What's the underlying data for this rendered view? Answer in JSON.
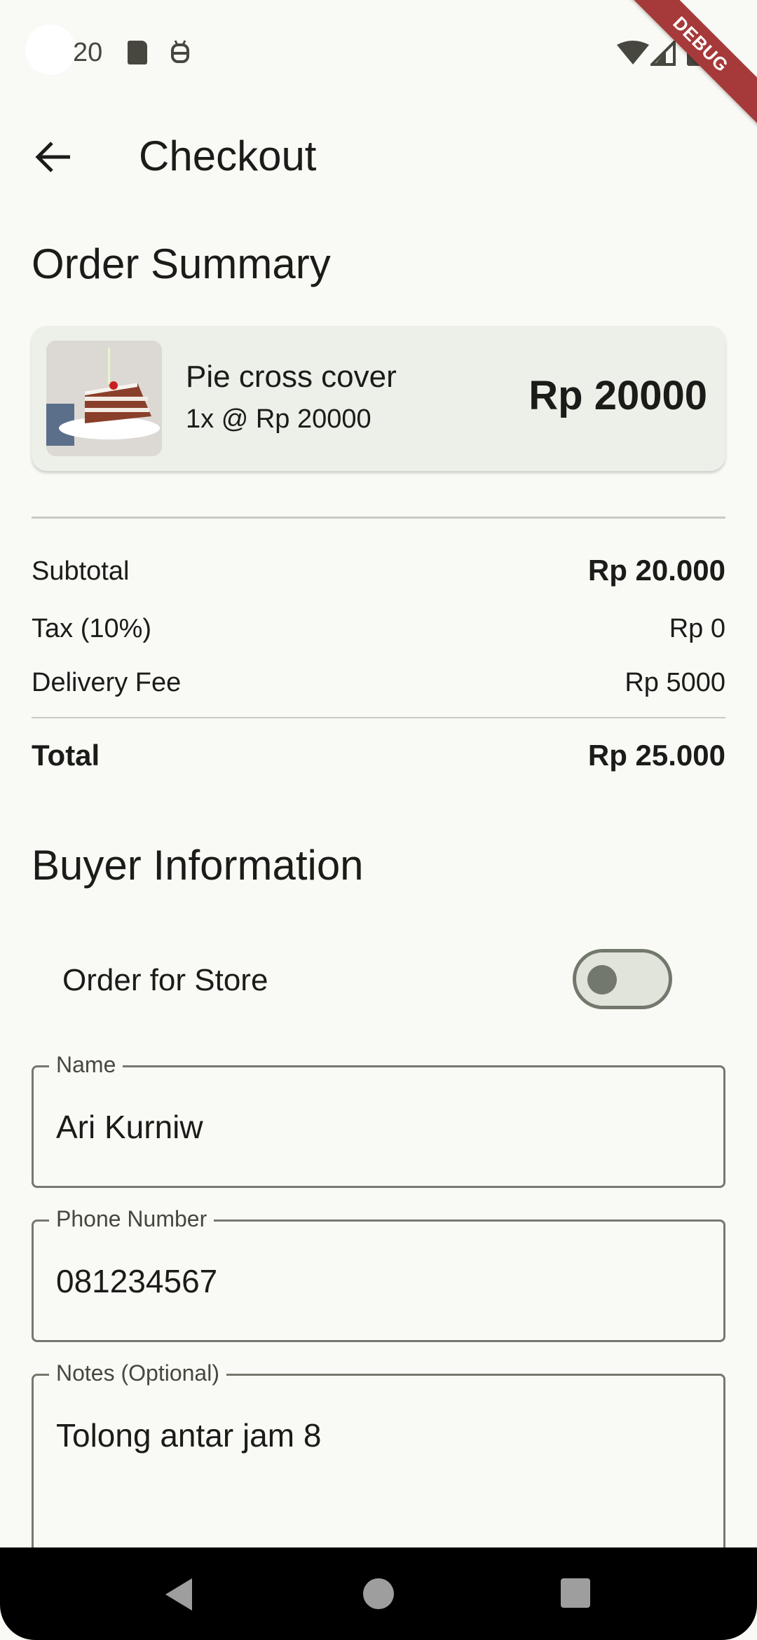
{
  "status_bar": {
    "time": "20"
  },
  "debug_banner": "DEBUG",
  "app_bar": {
    "title": "Checkout"
  },
  "order_summary": {
    "title": "Order Summary",
    "item": {
      "name": "Pie cross cover",
      "qty_price": "1x @ Rp 20000",
      "total": "Rp 20000"
    }
  },
  "totals": {
    "subtotal_label": "Subtotal",
    "subtotal_value": "Rp 20.000",
    "tax_label": "Tax (10%)",
    "tax_value": "Rp 0",
    "delivery_label": "Delivery Fee",
    "delivery_value": "Rp 5000",
    "total_label": "Total",
    "total_value": "Rp 25.000"
  },
  "buyer": {
    "title": "Buyer Information",
    "order_for_store_label": "Order for Store",
    "order_for_store_on": false,
    "name_label": "Name",
    "name_value": "Ari Kurniw",
    "phone_label": "Phone Number",
    "phone_value": "081234567",
    "notes_label": "Notes (Optional)",
    "notes_value": "Tolong antar jam 8"
  },
  "icons": {
    "back": "arrow-left-icon",
    "sd_card": "sd-card-icon",
    "bot": "android-bot-icon",
    "wifi": "wifi-icon",
    "signal": "cell-signal-icon",
    "battery": "battery-icon",
    "nav_back": "nav-back-icon",
    "nav_home": "nav-home-icon",
    "nav_recents": "nav-recents-icon"
  },
  "colors": {
    "background": "#f9faf5",
    "card": "#ecf0e8",
    "outline": "#75786f",
    "debug": "#a63a3a"
  }
}
